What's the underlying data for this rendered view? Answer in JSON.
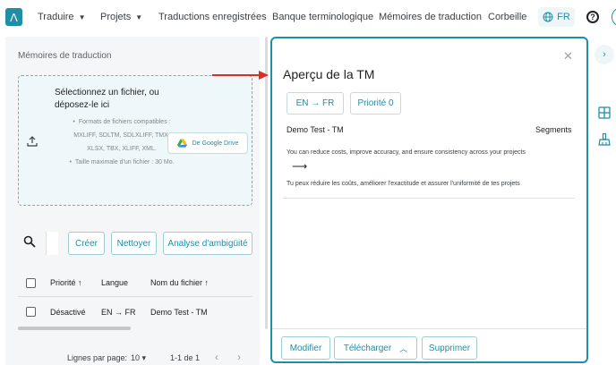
{
  "nav": {
    "translate": "Traduire",
    "projects": "Projets",
    "saved": "Traductions enregistrées",
    "termbase": "Banque terminologique",
    "memories": "Mémoires de traduction",
    "trash": "Corbeille",
    "lang": "FR",
    "help": "?"
  },
  "left": {
    "title": "Mémoires de traduction",
    "upload_title": "Sélectionnez un fichier, ou déposez-le ici",
    "formats": "Formats de fichiers compatibles : MXLIFF, SDLTM, SDLXLIFF, TMX, XLSX, TBX, XLIFF, XML.",
    "max_size": "Taille maximale d'un fichier : 30 Mo.",
    "gdrive": "De Google Drive",
    "buttons": {
      "create": "Créer",
      "clean": "Nettoyer",
      "analyze": "Analyse d'ambigüité"
    },
    "table": {
      "headers": {
        "priority": "Priorité",
        "language": "Langue",
        "filename": "Nom du fichier"
      },
      "rows": [
        {
          "priority": "Désactivé",
          "language": "EN → FR",
          "filename": "Demo Test - TM"
        }
      ]
    },
    "pager": {
      "rows_label": "Lignes par page:",
      "rows_value": "10",
      "range": "1-1 de 1"
    }
  },
  "modal": {
    "title": "Aperçu de la TM",
    "lang_chip": "EN → FR",
    "priority_chip": "Priorité 0",
    "tm_name": "Demo Test - TM",
    "segments_label": "Segments",
    "source": "You can reduce costs, improve accuracy, and ensure consistency across your projects",
    "target": "Tu peux réduire les coûts, améliorer l'exactitude et assurer l'uniformité de tes projets",
    "buttons": {
      "edit": "Modifier",
      "download": "Télécharger",
      "delete": "Supprimer"
    }
  },
  "colors": {
    "accent": "#1f8ea6",
    "annotation_arrow": "#d93025"
  }
}
